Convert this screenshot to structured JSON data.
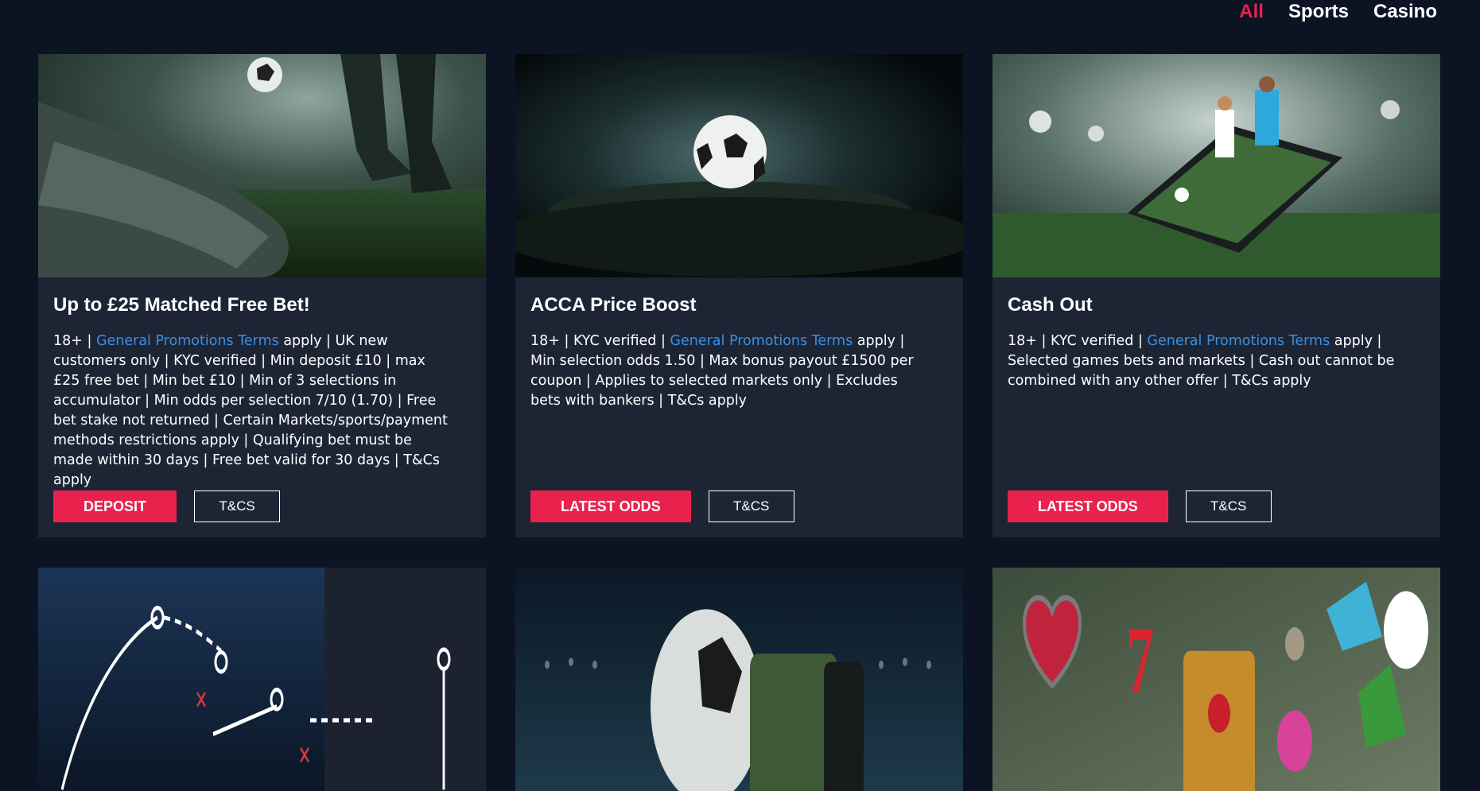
{
  "filters": [
    {
      "label": "All",
      "active": true
    },
    {
      "label": "Sports",
      "active": false
    },
    {
      "label": "Casino",
      "active": false
    }
  ],
  "cards": [
    {
      "title": "Up to £25 Matched Free Bet!",
      "text_before": "18+ | ",
      "link": "General Promotions Terms",
      "text_after": " apply | UK new customers only | KYC verified | Min deposit £10 | max £25 free bet | Min bet £10 | Min of 3 selections in accumulator | Min odds per selection 7/10 (1.70) | Free bet stake not returned | Certain Markets/sports/payment methods restrictions apply | Qualifying bet must be made within 30 days | Free bet valid for 30 days | T&Cs apply",
      "primary": "DEPOSIT",
      "secondary": "T&CS"
    },
    {
      "title": "ACCA Price Boost",
      "text_before": "18+ | KYC verified | ",
      "link": "General Promotions Terms",
      "text_after": " apply | Min selection odds 1.50 | Max bonus payout £1500 per coupon | Applies to selected markets only | Excludes bets with bankers | T&Cs apply",
      "primary": "LATEST ODDS",
      "secondary": "T&CS"
    },
    {
      "title": "Cash Out",
      "text_before": "18+ | KYC verified | ",
      "link": "General Promotions Terms",
      "text_after": " apply | Selected games bets and markets | Cash out cannot be combined with any other offer | T&Cs apply",
      "primary": "LATEST ODDS",
      "secondary": "T&CS"
    }
  ],
  "colors": {
    "background": "#0c1424",
    "card": "#1d2535",
    "accent": "#e8224d",
    "link": "#3a8fe0"
  }
}
